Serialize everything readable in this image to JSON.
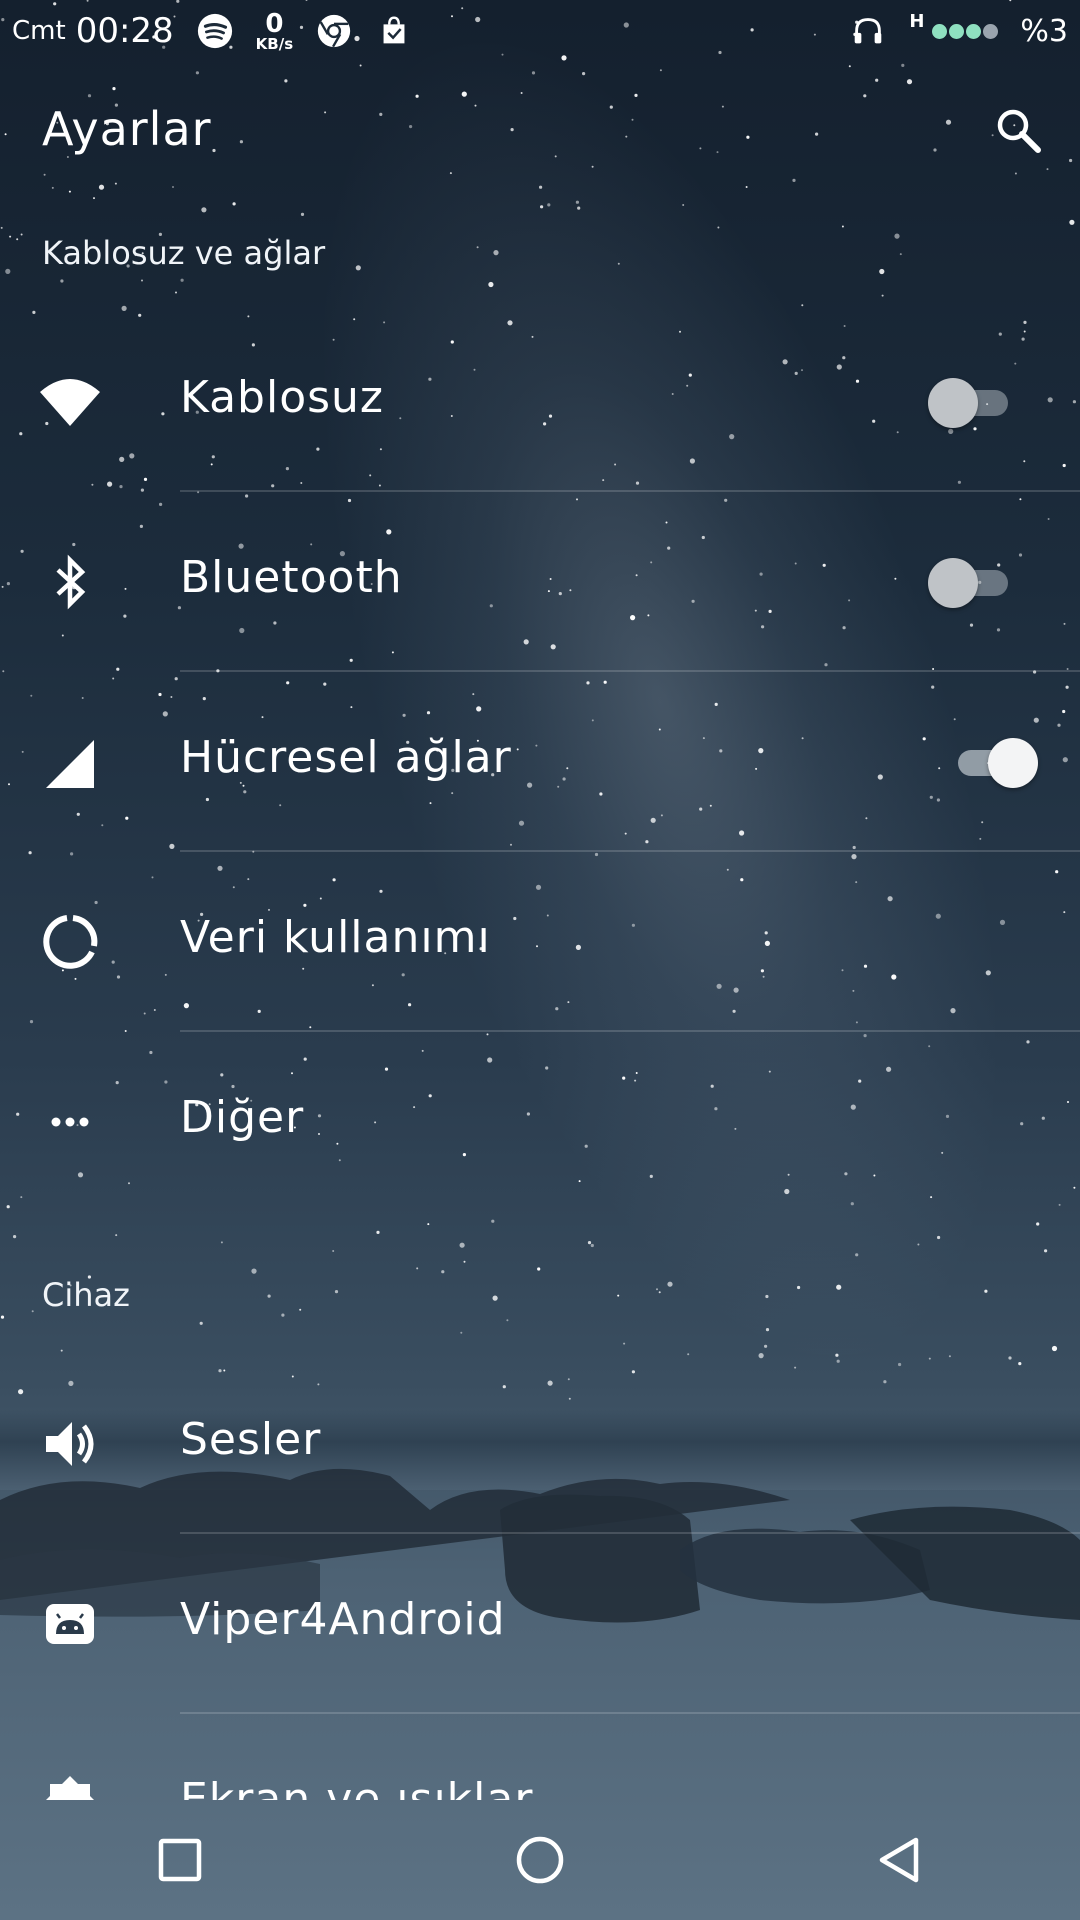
{
  "status_bar": {
    "day": "Cmt",
    "time": "00:28",
    "net_speed_value": "0",
    "net_speed_unit": "KB/s",
    "network_type": "H",
    "battery": "%3",
    "icons": [
      "spotify-icon",
      "chrome-icon",
      "shopping-bag-icon",
      "headphones-icon"
    ]
  },
  "app_bar": {
    "title": "Ayarlar",
    "search_icon": "search-icon"
  },
  "sections": [
    {
      "header": "Kablosuz ve ağlar",
      "items": [
        {
          "label": "Kablosuz",
          "icon": "wifi-icon",
          "toggle": "off"
        },
        {
          "label": "Bluetooth",
          "icon": "bluetooth-icon",
          "toggle": "off"
        },
        {
          "label": "Hücresel ağlar",
          "icon": "cellular-signal-icon",
          "toggle": "on"
        },
        {
          "label": "Veri kullanımı",
          "icon": "data-usage-icon"
        },
        {
          "label": "Diğer",
          "icon": "more-dots-icon"
        }
      ]
    },
    {
      "header": "Cihaz",
      "items": [
        {
          "label": "Sesler",
          "icon": "volume-icon"
        },
        {
          "label": "Viper4Android",
          "icon": "android-icon"
        },
        {
          "label": "Ekran ve ışıklar",
          "icon": "display-icon"
        }
      ]
    }
  ],
  "nav_bar": {
    "buttons": [
      "recents-square-icon",
      "home-circle-icon",
      "back-triangle-icon"
    ]
  },
  "colors": {
    "accent_signal": "#8fe0c0",
    "background_top": "#14202e",
    "background_bottom": "#5c7284"
  }
}
